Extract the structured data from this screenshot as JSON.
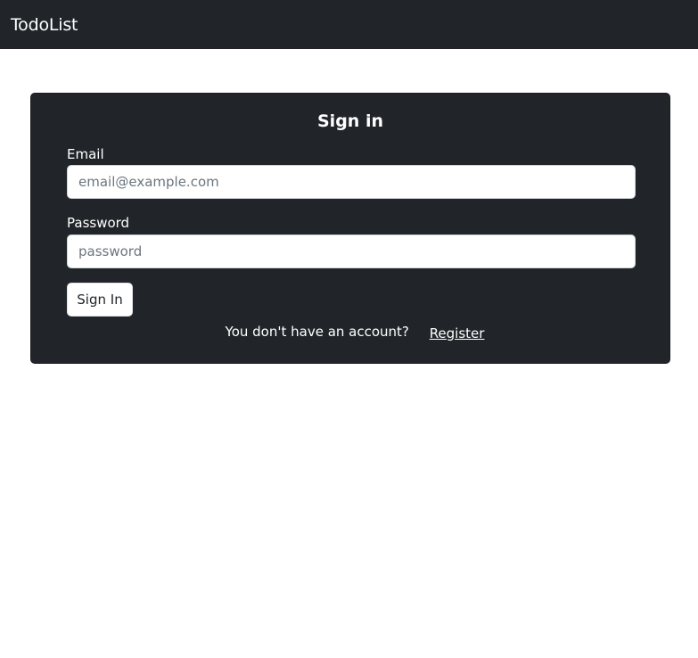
{
  "navbar": {
    "brand": "TodoList"
  },
  "signin_card": {
    "title": "Sign in",
    "email": {
      "label": "Email",
      "value": "",
      "placeholder": "email@example.com"
    },
    "password": {
      "label": "Password",
      "value": "",
      "placeholder": "password"
    },
    "submit_label": "Sign In",
    "register_prompt": "You don't have an account?",
    "register_link": "Register"
  },
  "colors": {
    "dark": "#212529",
    "light": "#ffffff"
  }
}
